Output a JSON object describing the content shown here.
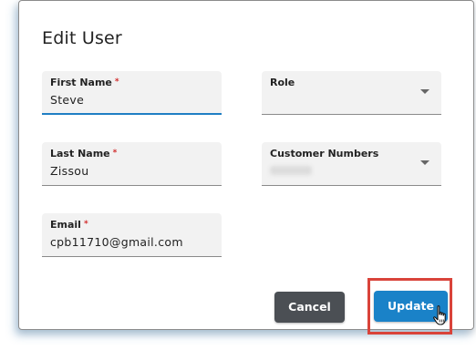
{
  "dialog": {
    "title": "Edit User"
  },
  "fields": {
    "first_name": {
      "label": "First Name",
      "required_mark": "*",
      "value": "Steve"
    },
    "last_name": {
      "label": "Last Name",
      "required_mark": "*",
      "value": "Zissou"
    },
    "email": {
      "label": "Email",
      "required_mark": "*",
      "value": "cpb11710@gmail.com"
    },
    "role": {
      "label": "Role",
      "value": ""
    },
    "customer_numbers": {
      "label": "Customer Numbers",
      "value": ""
    }
  },
  "buttons": {
    "cancel_label": "Cancel",
    "update_label": "Update"
  },
  "colors": {
    "update_button": "#1a82c8",
    "cancel_button": "#4b4f54",
    "highlight_box": "#d9433a",
    "active_underline": "#1f7fc4",
    "required_asterisk": "#d12b2b"
  },
  "icons": {
    "dropdown": "chevron-down-icon",
    "cursor": "hand-pointer-icon"
  }
}
